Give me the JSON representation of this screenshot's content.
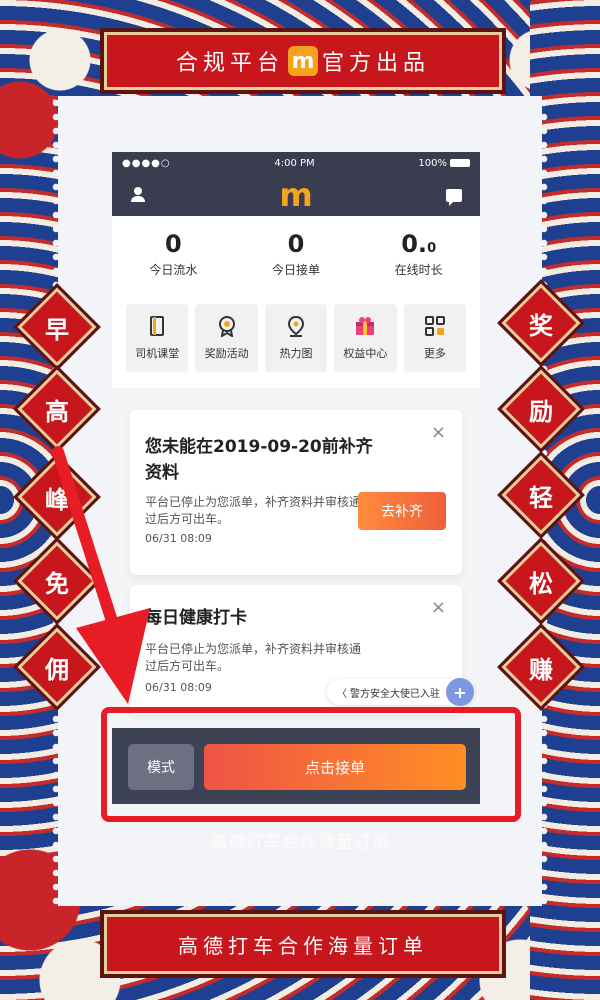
{
  "top_banner": {
    "left": "合规平台",
    "logo": "m",
    "right": "官方出品"
  },
  "bottom_banner": "高德打车合作海量订单",
  "left_slogan": [
    "早",
    "高",
    "峰",
    "免",
    "佣"
  ],
  "right_slogan": [
    "奖",
    "励",
    "轻",
    "松",
    "赚"
  ],
  "status_bar": {
    "signal": "●●●●○",
    "time": "4:00 PM",
    "battery": "100%"
  },
  "app_logo": "m",
  "stats": [
    {
      "value": "0",
      "value_suffix": "",
      "label": "今日流水"
    },
    {
      "value": "0",
      "value_suffix": "",
      "label": "今日接单"
    },
    {
      "value": "0.",
      "value_suffix": "0",
      "label": "在线时长"
    }
  ],
  "quick_menu": [
    {
      "label": "司机课堂",
      "icon": "book-icon"
    },
    {
      "label": "奖励活动",
      "icon": "medal-icon"
    },
    {
      "label": "热力图",
      "icon": "map-pin-icon"
    },
    {
      "label": "权益中心",
      "icon": "gift-icon"
    },
    {
      "label": "更多",
      "icon": "grid-icon"
    }
  ],
  "card_notice": {
    "title": "您未能在2019-09-20前补齐资料",
    "body": "平台已停止为您派单，补齐资料并审核通过后方可出车。",
    "time": "06/31 08:09",
    "button": "去补齐",
    "close": "×"
  },
  "card_health": {
    "title": "每日健康打卡",
    "body": "平台已停止为您派单，补齐资料并审核通过后方可出车。",
    "time": "06/31 08:09",
    "close": "×"
  },
  "safety_tip": "〈 警方安全大使已入驻",
  "safety_plus": "+",
  "mode_button": "模式",
  "accept_button": "点击接单",
  "watermark": "高德打车合作海量订单"
}
